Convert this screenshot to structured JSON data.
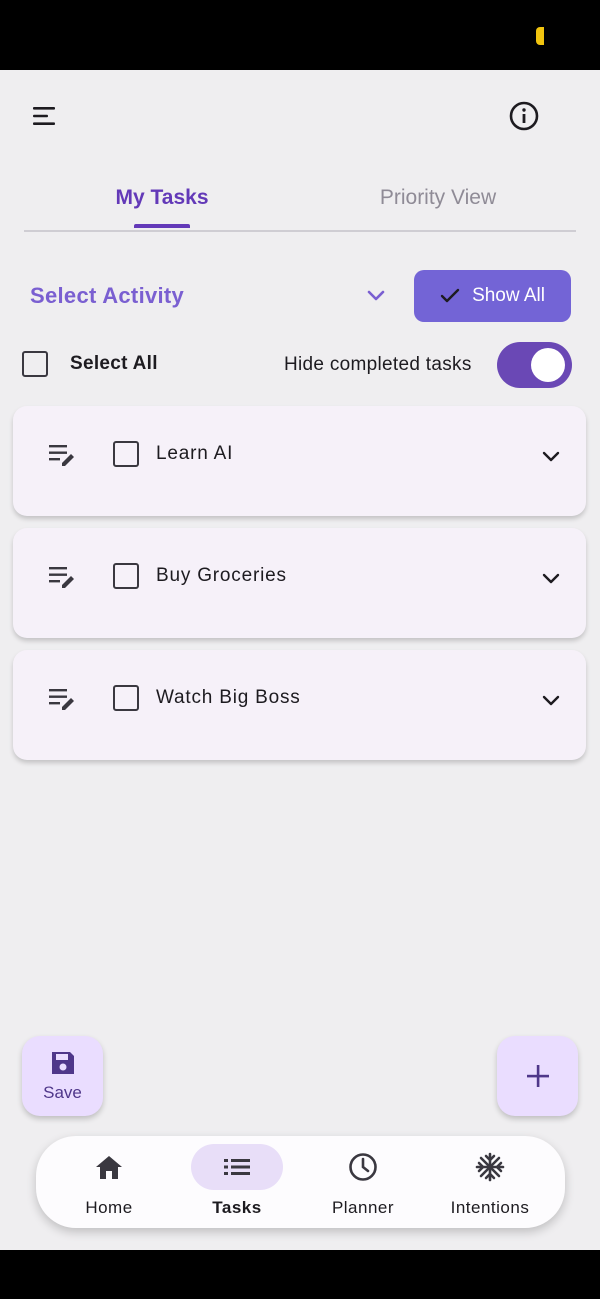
{
  "header": {
    "menu_icon": "menu-icon",
    "info_icon": "info-icon"
  },
  "tabs": [
    {
      "label": "My Tasks",
      "active": true
    },
    {
      "label": "Priority View",
      "active": false
    }
  ],
  "filter": {
    "activity_placeholder": "Select Activity",
    "show_all_label": "Show All"
  },
  "controls": {
    "select_all_label": "Select All",
    "hide_completed_label": "Hide completed tasks",
    "hide_completed_on": true
  },
  "tasks": [
    {
      "title": "Learn AI",
      "done": false
    },
    {
      "title": "Buy Groceries",
      "done": false
    },
    {
      "title": "Watch Big Boss",
      "done": false
    }
  ],
  "fabs": {
    "save_label": "Save",
    "add_icon": "plus-icon"
  },
  "nav": [
    {
      "label": "Home",
      "icon": "home-icon",
      "active": false
    },
    {
      "label": "Tasks",
      "icon": "list-icon",
      "active": true
    },
    {
      "label": "Planner",
      "icon": "clock-icon",
      "active": false
    },
    {
      "label": "Intentions",
      "icon": "snowflake-icon",
      "active": false
    }
  ],
  "colors": {
    "primary": "#6339b8",
    "button": "#7364d6",
    "card": "#f6f1f9",
    "fab": "#eaddff"
  }
}
